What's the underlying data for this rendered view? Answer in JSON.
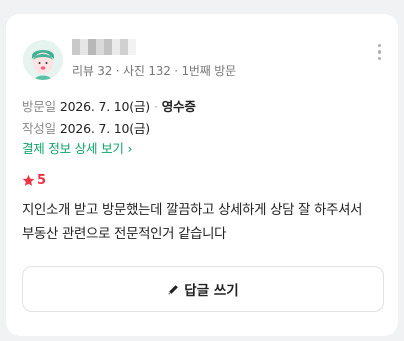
{
  "reviewer": {
    "avatar_icon": "cartoon-face-avatar",
    "stats": {
      "reviews": "리뷰 32",
      "photos": "사진 132",
      "visit_count": "1번째 방문"
    }
  },
  "visit": {
    "label": "방문일",
    "date": "2026. 7. 10(금)",
    "verification": "영수증"
  },
  "written": {
    "label": "작성일",
    "date": "2026. 7. 10(금)"
  },
  "payment_detail_link": "결제 정보 상세 보기 ›",
  "rating": {
    "value": "5",
    "icon": "star-icon",
    "color": "#ee3344"
  },
  "review_text": "지인소개 받고 방문했는데 깔끔하고 상세하게 상담 잘 하주셔서 부동산 관련으로 전문적인거 같습니다",
  "reply_button": {
    "icon": "pencil-icon",
    "label": "답글 쓰기"
  },
  "colors": {
    "link": "#10a36a",
    "accent": "#ee3344"
  }
}
